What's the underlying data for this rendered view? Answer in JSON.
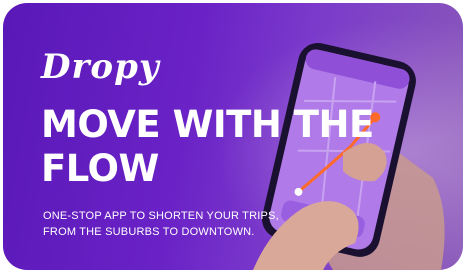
{
  "brand": {
    "logo_text": "Dropy"
  },
  "hero": {
    "headline_line1": "MOVE WITH THE",
    "headline_line2": "FLOW",
    "tagline_line1": "ONE-STOP APP TO SHORTEN YOUR TRIPS,",
    "tagline_line2": "FROM THE SUBURBS TO DOWNTOWN."
  },
  "colors": {
    "card_purple": "#6a22c6",
    "phone_screen": "#b07be8",
    "route": "#ff6a2b",
    "text": "#ffffff"
  },
  "icons": [
    "phone-mockup",
    "hand",
    "map-pin-icon"
  ]
}
